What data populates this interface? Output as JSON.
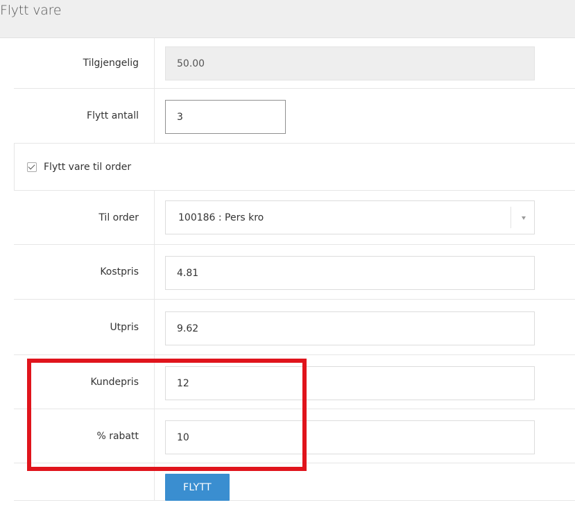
{
  "dialog": {
    "title": "Flytt vare"
  },
  "form": {
    "available": {
      "label": "Tilgjengelig",
      "value": "50.00"
    },
    "move_quantity": {
      "label": "Flytt antall",
      "value": "3"
    },
    "move_to_order": {
      "label": "Flytt vare til order",
      "checked": true
    },
    "to_order": {
      "label": "Til order",
      "value": "100186 : Pers kro"
    },
    "cost_price": {
      "label": "Kostpris",
      "value": "4.81"
    },
    "sale_price": {
      "label": "Utpris",
      "value": "9.62"
    },
    "customer_price": {
      "label": "Kundepris",
      "value": "12"
    },
    "discount": {
      "label": "% rabatt",
      "value": "10"
    },
    "submit_label": "FLYTT"
  },
  "colors": {
    "accent": "#3a8ed0",
    "highlight": "#e0141c",
    "header_bg": "#efefef"
  }
}
